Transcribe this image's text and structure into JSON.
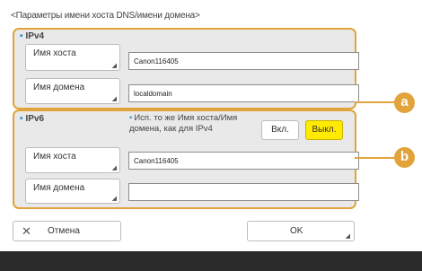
{
  "title": "<Параметры имени хоста DNS/имени домена>",
  "ipv4": {
    "label": "IPv4",
    "host_name_label": "Имя хоста",
    "host_name_value": "Canon116405",
    "domain_name_label": "Имя домена",
    "domain_name_value": "localdomain"
  },
  "ipv6": {
    "label": "IPv6",
    "same_as_ipv4_label": "Исп. то же Имя хоста/Имя домена, как для IPv4",
    "on_label": "Вкл.",
    "off_label": "Выкл.",
    "selected": "off",
    "host_name_label": "Имя хоста",
    "host_name_value": "Canon116405",
    "domain_name_label": "Имя домена",
    "domain_name_value": ""
  },
  "callouts": {
    "a": "a",
    "b": "b"
  },
  "buttons": {
    "cancel_label": "Отмена",
    "ok_label": "OK"
  },
  "colors": {
    "accent": "#e1a33a",
    "selected_toggle": "#ffea00",
    "bullet": "#1c8fd8"
  }
}
